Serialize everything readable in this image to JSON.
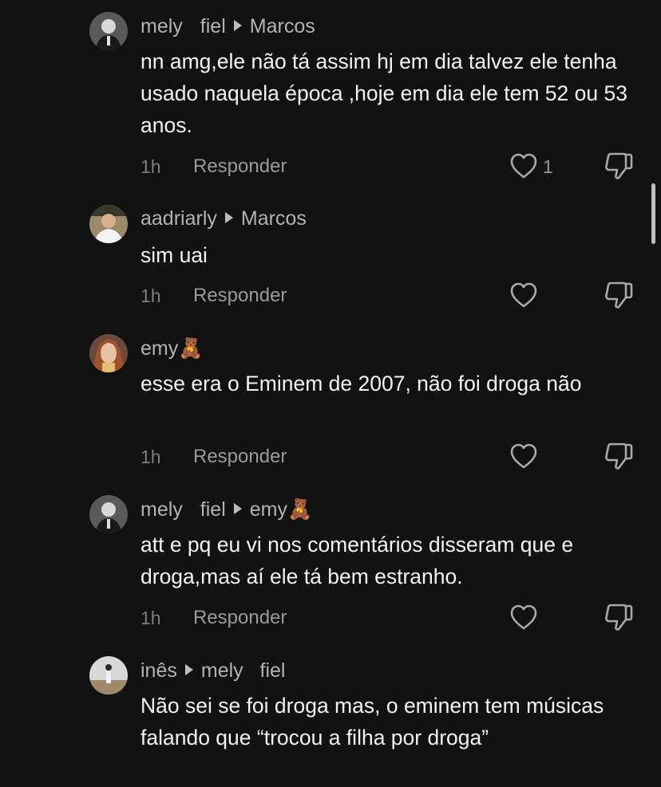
{
  "comments": [
    {
      "user": "mely",
      "user_suffix": "fiel",
      "target": "Marcos",
      "text": "nn amg,ele não tá assim hj em dia talvez ele tenha usado naquela época ,hoje em dia ele tem 52 ou 53 anos.",
      "time": "1h",
      "reply": "Responder",
      "likes": "1"
    },
    {
      "user": "aadriarly",
      "user_suffix": "",
      "target": "Marcos",
      "text": "sim uai",
      "time": "1h",
      "reply": "Responder",
      "likes": ""
    },
    {
      "user": "emy🧸",
      "user_suffix": "",
      "target": "",
      "text": "esse era o Eminem de 2007, não foi droga não",
      "time": "1h",
      "reply": "Responder",
      "likes": ""
    },
    {
      "user": "mely",
      "user_suffix": "fiel",
      "target": "emy🧸",
      "text": "att e pq eu vi nos comentários disseram que e droga,mas aí ele tá bem estranho.",
      "time": "1h",
      "reply": "Responder",
      "likes": ""
    },
    {
      "user": "inês",
      "user_suffix": "",
      "target": "mely   fiel",
      "text": "Não sei se foi droga mas, o eminem tem músicas falando que “trocou a filha por droga”",
      "time": "",
      "reply": "",
      "likes": ""
    }
  ],
  "icons": {
    "like": "heart-outline-icon",
    "dislike": "thumbs-down-outline-icon",
    "reply_arrow": "triangle-right-icon"
  }
}
